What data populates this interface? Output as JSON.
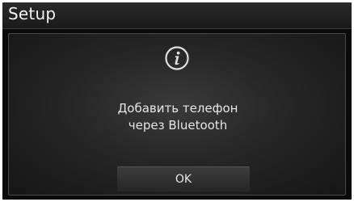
{
  "header": {
    "title": "Setup"
  },
  "dialog": {
    "icon": "info-icon",
    "message_line1": "Добавить телефон",
    "message_line2": "через Bluetooth",
    "ok_label": "OK"
  },
  "colors": {
    "background": "#0c0c0c",
    "text": "#e6e6e6",
    "frame": "#ffffff"
  }
}
